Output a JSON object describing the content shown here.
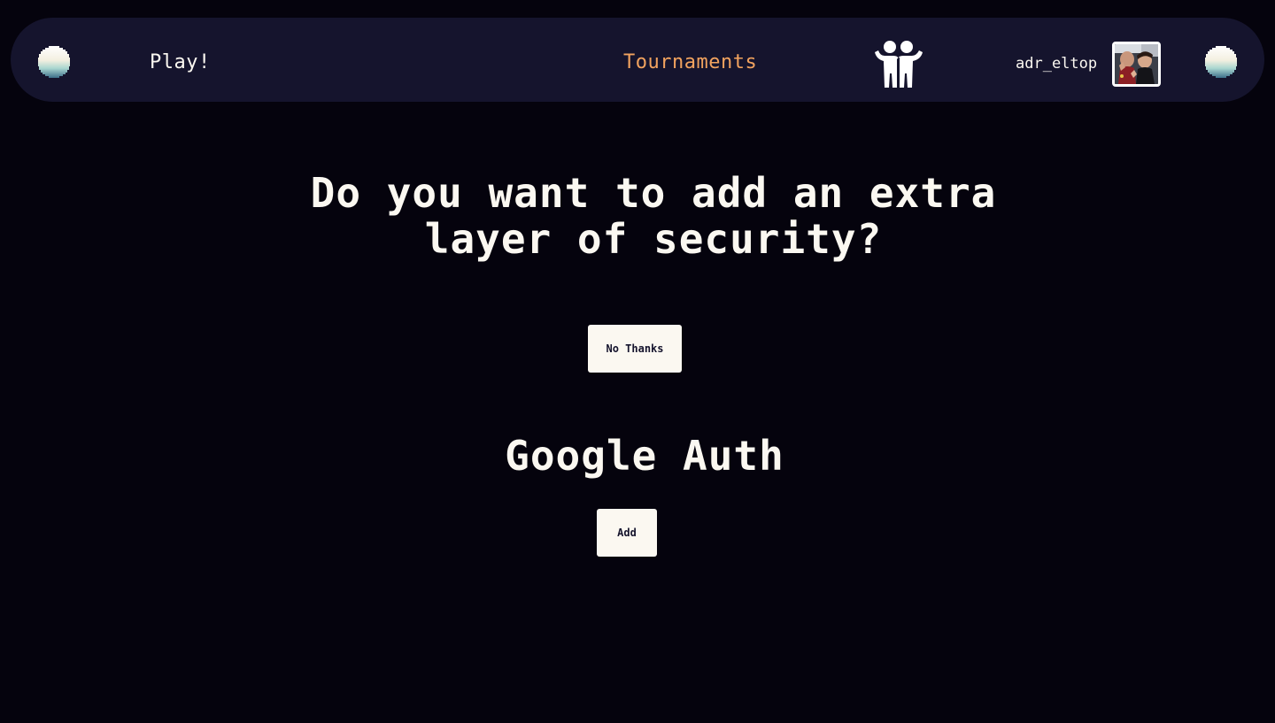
{
  "nav": {
    "play_label": "Play!",
    "tournaments_label": "Tournaments",
    "username": "adr_eltop",
    "left_icon": "moon-icon",
    "right_icon": "moon-icon",
    "friends_icon": "friends-icon",
    "active_link_color": "#f2a35f"
  },
  "security": {
    "title": "Do you want to add an extra layer of security?",
    "no_thanks_label": "No Thanks"
  },
  "google_auth": {
    "title": "Google Auth",
    "add_label": "Add"
  },
  "colors": {
    "background": "#05030d",
    "navbar": "#15142d",
    "text": "#fbf8f1",
    "accent": "#f2a35f"
  }
}
